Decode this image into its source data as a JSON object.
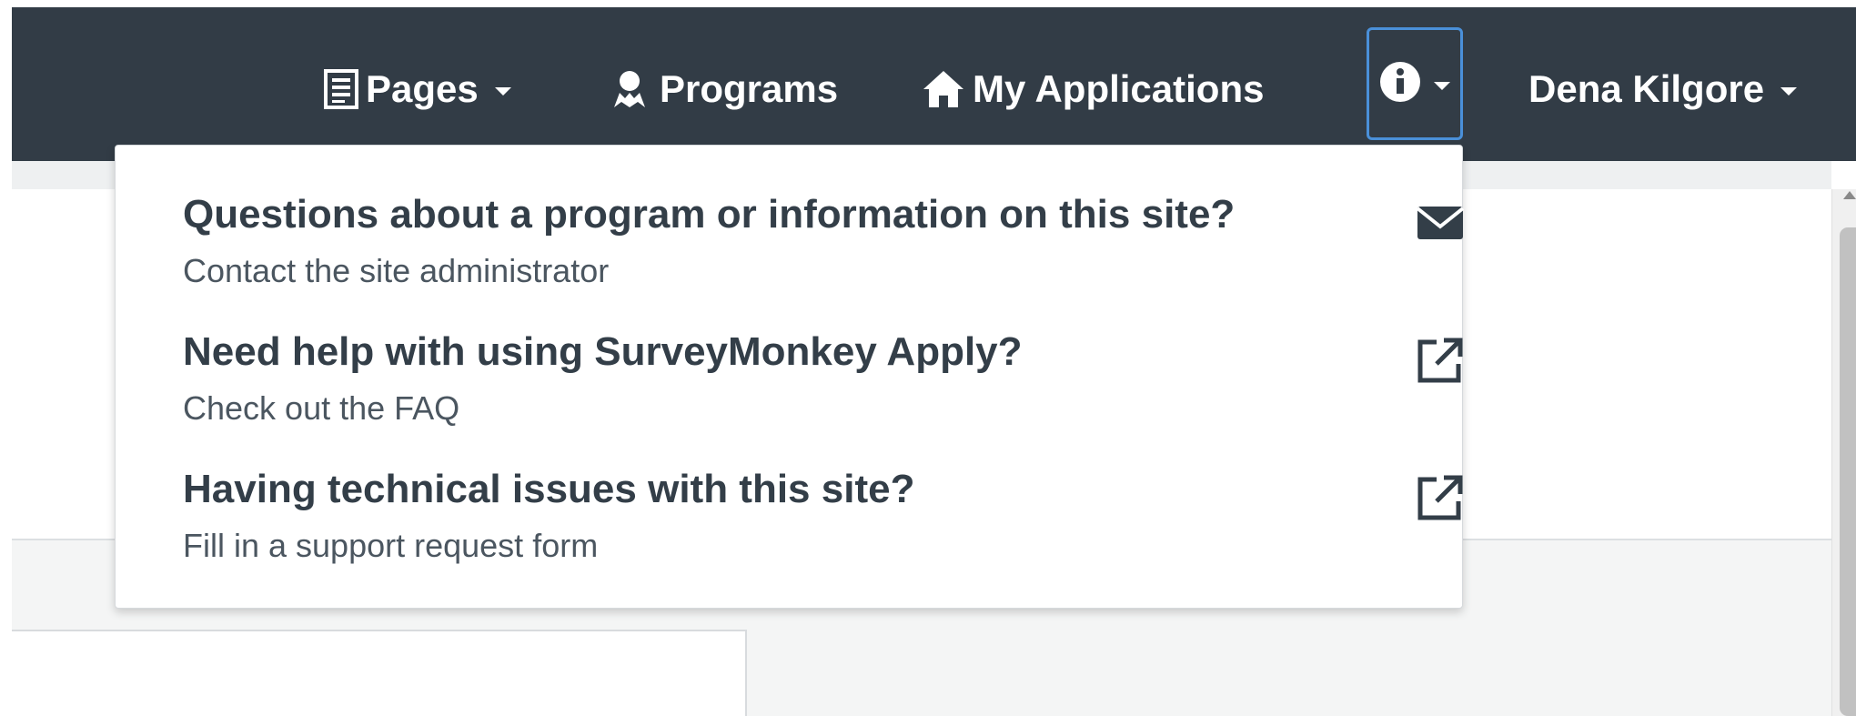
{
  "navbar": {
    "pages_label": "Pages",
    "programs_label": "Programs",
    "applications_label": "My Applications",
    "user_name": "Dena Kilgore",
    "bg_color": "#323c46",
    "focus_color": "#4a90d9"
  },
  "icons": {
    "pages": "document-icon",
    "programs": "people-icon",
    "applications": "home-icon",
    "info": "info-circle-icon",
    "contact": "envelope-icon",
    "faq": "external-link-icon",
    "support": "external-link-icon"
  },
  "help_menu": {
    "items": [
      {
        "title": "Questions about a program or information on this site?",
        "subtitle": "Contact the site administrator"
      },
      {
        "title": "Need help with using SurveyMonkey Apply?",
        "subtitle": "Check out the FAQ"
      },
      {
        "title": "Having technical issues with this site?",
        "subtitle": "Fill in a support request form"
      }
    ]
  }
}
